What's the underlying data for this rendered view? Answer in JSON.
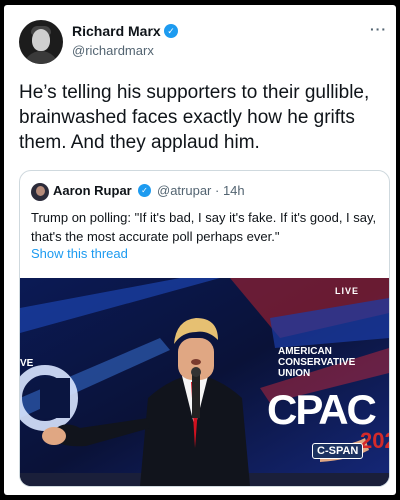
{
  "tweet": {
    "author_name": "Richard Marx",
    "author_handle": "@richardmarx",
    "more_icon": "···",
    "verified_icon": "✓",
    "text": "He’s telling his supporters to their gullible, brainwashed faces exactly how he grifts them. And they applaud him."
  },
  "quoted": {
    "author_name": "Aaron Rupar",
    "author_handle": "@atrupar · 14h",
    "verified_icon": "✓",
    "text": "Trump on polling: \"If it's bad, I say it's fake. If it's good, I say, that's the most accurate poll perhaps ever.\"",
    "show_thread": "Show this thread",
    "video": {
      "live_label": "LIVE",
      "stage_banner": "AMERICAN CONSERVATIVE UNION",
      "left_fragment": "VE",
      "logo_text": "CPAC",
      "year_fragment": "202",
      "network_bug": "C-SPAN"
    }
  },
  "colors": {
    "accent": "#1d9bf0",
    "text": "#0f1419",
    "muted": "#536471",
    "video_bg": "#0a1540"
  }
}
